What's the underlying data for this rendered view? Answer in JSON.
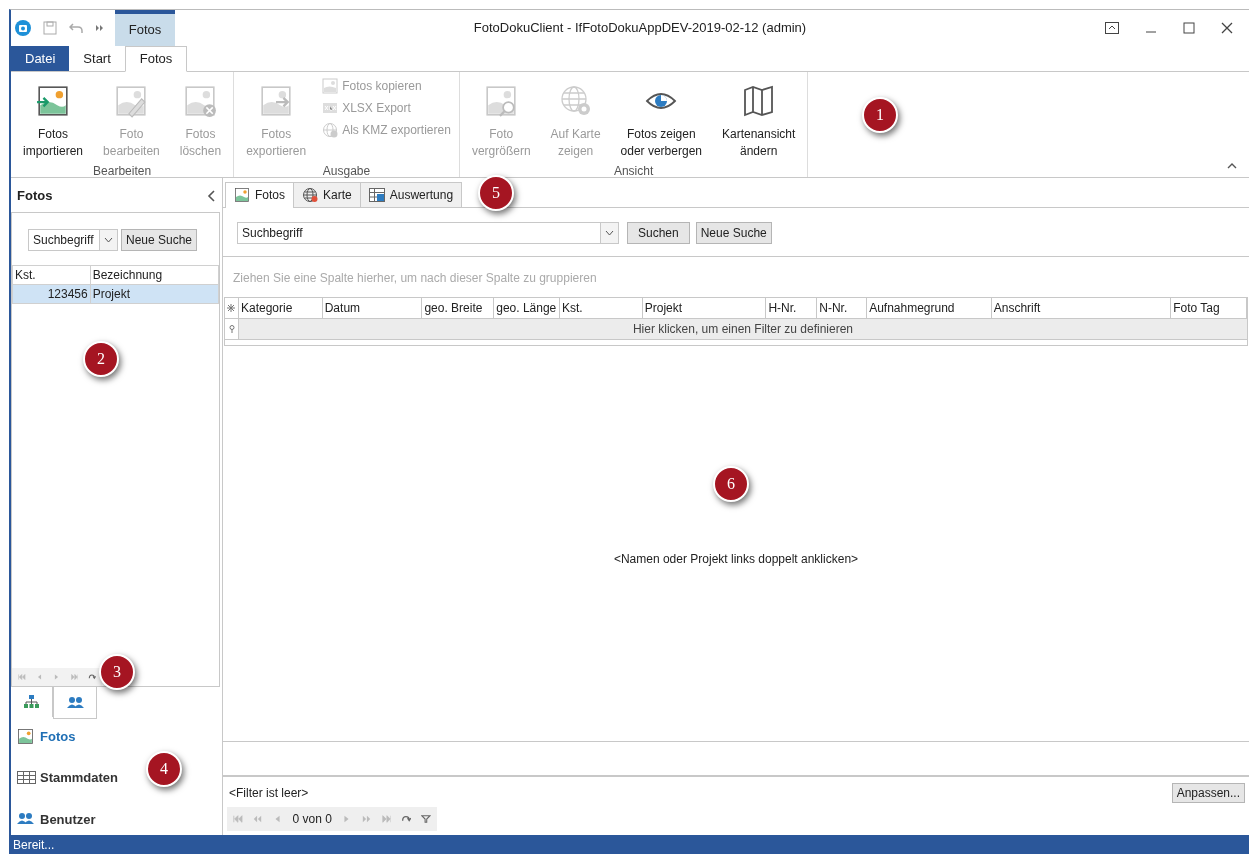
{
  "window": {
    "title": "FotoDokuClient - IfFotoDokuAppDEV-2019-02-12 (admin)",
    "context_tab": "Fotos"
  },
  "ribbon_tabs": [
    {
      "label": "Datei",
      "kind": "file",
      "selected": false
    },
    {
      "label": "Start",
      "kind": "tab",
      "selected": false
    },
    {
      "label": "Fotos",
      "kind": "tab",
      "selected": true
    }
  ],
  "ribbon_groups": [
    {
      "label": "Bearbeiten",
      "items": [
        {
          "kind": "large",
          "lines": [
            "Fotos",
            "importieren"
          ],
          "disabled": false
        },
        {
          "kind": "large",
          "lines": [
            "Foto",
            "bearbeiten"
          ],
          "disabled": true
        },
        {
          "kind": "large",
          "lines": [
            "Fotos",
            "löschen"
          ],
          "disabled": true
        }
      ]
    },
    {
      "label": "Ausgabe",
      "items": [
        {
          "kind": "large",
          "lines": [
            "Fotos",
            "exportieren"
          ],
          "disabled": true
        },
        {
          "kind": "small",
          "lines": [
            "Fotos kopieren"
          ],
          "disabled": true
        },
        {
          "kind": "small",
          "lines": [
            "XLSX Export"
          ],
          "disabled": true
        },
        {
          "kind": "small",
          "lines": [
            "Als KMZ exportieren"
          ],
          "disabled": true
        }
      ]
    },
    {
      "label": "Ansicht",
      "items": [
        {
          "kind": "large",
          "lines": [
            "Foto",
            "vergrößern"
          ],
          "disabled": true
        },
        {
          "kind": "large",
          "lines": [
            "Auf Karte",
            "zeigen"
          ],
          "disabled": true
        },
        {
          "kind": "large",
          "lines": [
            "Fotos zeigen",
            "oder verbergen"
          ],
          "disabled": false
        },
        {
          "kind": "large",
          "lines": [
            "Kartenansicht",
            "ändern"
          ],
          "disabled": false
        }
      ]
    }
  ],
  "sidebar": {
    "title": "Fotos",
    "search": {
      "value": "Suchbegriff",
      "button": "Neue Suche"
    },
    "table": {
      "columns": [
        "Kst.",
        "Bezeichnung"
      ],
      "rows": [
        {
          "cells": [
            "123456",
            "Projekt"
          ],
          "selected": true
        }
      ]
    },
    "view_tabs": [
      {
        "selected": false
      },
      {
        "selected": true
      }
    ],
    "nav": [
      {
        "label": "Fotos",
        "selected": true
      },
      {
        "label": "Stammdaten",
        "selected": false
      },
      {
        "label": "Benutzer",
        "selected": false
      }
    ]
  },
  "main": {
    "tabs": [
      {
        "label": "Fotos",
        "selected": true
      },
      {
        "label": "Karte",
        "selected": false
      },
      {
        "label": "Auswertung",
        "selected": false
      }
    ],
    "search": {
      "value": "Suchbegriff",
      "buttons": [
        "Suchen",
        "Neue Suche"
      ]
    },
    "group_hint": "Ziehen Sie eine Spalte hierher, um nach dieser Spalte zu gruppieren",
    "grid": {
      "columns": [
        "Kategorie",
        "Datum",
        "geo. Breite",
        "geo. Länge",
        "Kst.",
        "Projekt",
        "H-Nr.",
        "N-Nr.",
        "Aufnahmegrund",
        "Anschrift",
        "Foto Tag"
      ],
      "filter_hint": "Hier klicken, um einen Filter zu definieren",
      "empty_text": "<Namen oder Projekt links doppelt anklicken>"
    },
    "filter_status": "<Filter ist leer>",
    "customize_button": "Anpassen...",
    "pager": "0 von 0"
  },
  "callouts": [
    "1",
    "2",
    "3",
    "4",
    "5",
    "6"
  ],
  "status_bar": "Bereit..."
}
